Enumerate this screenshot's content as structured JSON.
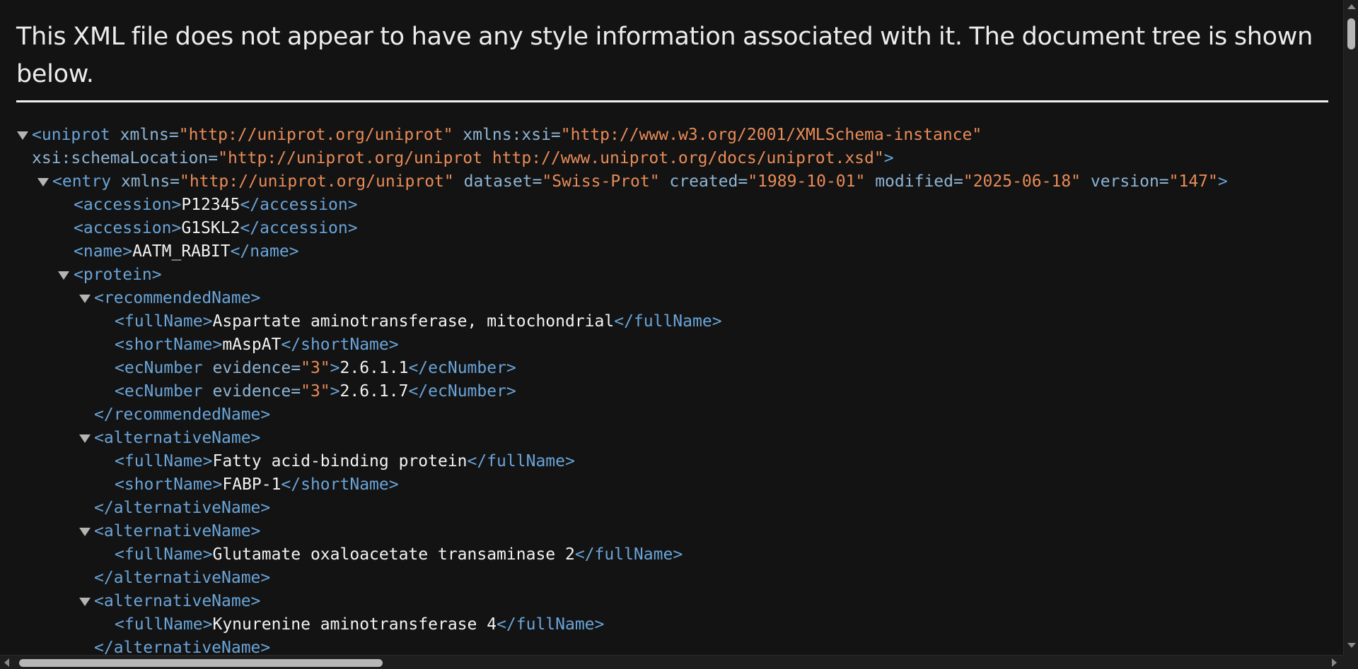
{
  "banner": "This XML file does not appear to have any style information associated with it. The document tree is shown below.",
  "tree": {
    "uniprot_open": "<uniprot",
    "xmlns_attr": " xmlns=",
    "xmlns_val": "\"http://uniprot.org/uniprot\"",
    "xsi_attr": " xmlns:xsi=",
    "xsi_val": "\"http://www.w3.org/2001/XMLSchema-instance\"",
    "schema_attr": "xsi:schemaLocation=",
    "schema_val": "\"http://uniprot.org/uniprot http://www.uniprot.org/docs/uniprot.xsd\"",
    "close_bracket": ">",
    "entry_open": "<entry",
    "entry_xmlns_attr": " xmlns=",
    "entry_xmlns_val": "\"http://uniprot.org/uniprot\"",
    "dataset_attr": " dataset=",
    "dataset_val": "\"Swiss-Prot\"",
    "created_attr": " created=",
    "created_val": "\"1989-10-01\"",
    "modified_attr": " modified=",
    "modified_val": "\"2025-06-18\"",
    "version_attr": " version=",
    "version_val": "\"147\"",
    "accession_open": "<accession>",
    "accession_close": "</accession>",
    "accession_1": "P12345",
    "accession_2": "G1SKL2",
    "name_open": "<name>",
    "name_close": "</name>",
    "name_value": "AATM_RABIT",
    "protein_open": "<protein>",
    "recommended_open": "<recommendedName>",
    "recommended_close": "</recommendedName>",
    "fullname_open": "<fullName>",
    "fullname_close": "</fullName>",
    "shortname_open": "<shortName>",
    "shortname_close": "</shortName>",
    "ecnumber_open": "<ecNumber",
    "ecnumber_close": "</ecNumber>",
    "evidence_attr": " evidence=",
    "evidence_val": "\"3\"",
    "alternative_open": "<alternativeName>",
    "alternative_close": "</alternativeName>",
    "recommended_fullname": "Aspartate aminotransferase, mitochondrial",
    "recommended_shortname": "mAspAT",
    "ec_1": "2.6.1.1",
    "ec_2": "2.6.1.7",
    "alt1_fullname": "Fatty acid-binding protein",
    "alt1_shortname": "FABP-1",
    "alt2_fullname": "Glutamate oxaloacetate transaminase 2",
    "alt3_fullname": "Kynurenine aminotransferase 4"
  }
}
